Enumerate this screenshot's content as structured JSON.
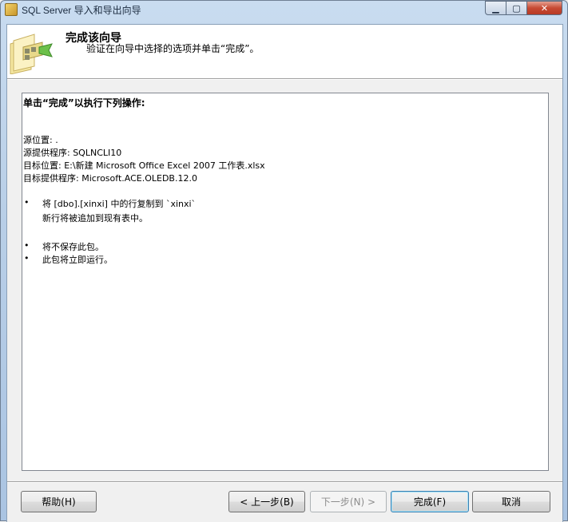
{
  "window": {
    "title": "SQL Server 导入和导出向导",
    "controls": {
      "minimize": "▁",
      "maximize": "▢",
      "close": "✕"
    }
  },
  "header": {
    "title": "完成该向导",
    "subtitle": "验证在向导中选择的选项并单击“完成”。",
    "icon": "wizard-folder-icon"
  },
  "summary": {
    "heading": "单击“完成”以执行下列操作:",
    "source_location": "源位置: .",
    "source_provider": "源提供程序: SQLNCLI10",
    "dest_location": "目标位置: E:\\新建 Microsoft Office Excel 2007 工作表.xlsx",
    "dest_provider": "目标提供程序: Microsoft.ACE.OLEDB.12.0",
    "bullets": [
      {
        "mark": "•",
        "text": "将 [dbo].[xinxi] 中的行复制到 `xinxi`",
        "sub": "新行将被追加到现有表中。"
      },
      {
        "mark": "•",
        "text": "将不保存此包。"
      },
      {
        "mark": "•",
        "text": "此包将立即运行。"
      }
    ]
  },
  "buttons": {
    "help": "帮助(H)",
    "back": "< 上一步(B)",
    "next": "下一步(N) >",
    "finish": "完成(F)",
    "cancel": "取消"
  },
  "colors": {
    "accent": "#3c7fb1",
    "title_bar": "#b9cfe7",
    "disabled_text": "#8d8d8d"
  }
}
